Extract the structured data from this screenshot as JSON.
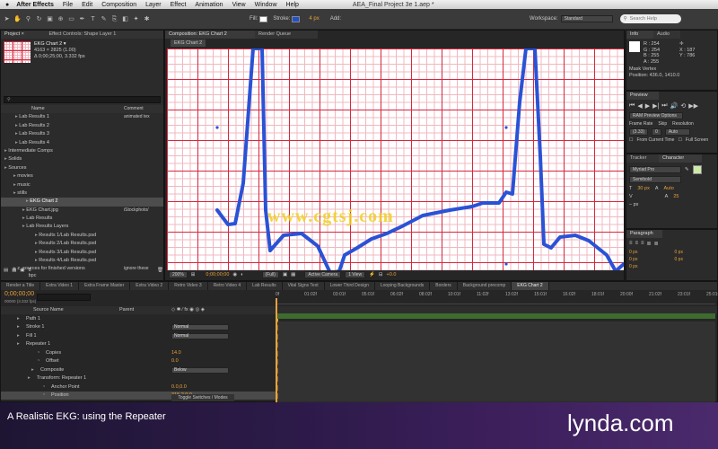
{
  "menubar": {
    "app": "After Effects",
    "items": [
      "File",
      "Edit",
      "Composition",
      "Layer",
      "Effect",
      "Animation",
      "View",
      "Window",
      "Help"
    ],
    "doc_title": "AEA_Final Project 3e 1.aep *"
  },
  "toolbar": {
    "fill_label": "Fill:",
    "stroke_label": "Stroke:",
    "stroke_width": "4 px",
    "add_label": "Add:",
    "workspace_label": "Workspace:",
    "workspace_value": "Standard",
    "search_placeholder": "Search Help"
  },
  "project": {
    "tab_project": "Project ×",
    "tab_effect": "Effect Controls: Shape Layer 1",
    "item_name": "EKG Chart 2 ▾",
    "item_size": "4163 × 2825 (1.00)",
    "item_duration": "Δ 0;00;25;00, 3.332 fps",
    "col_name": "Name",
    "col_comment": "Comment",
    "search_placeholder": "",
    "rows": [
      {
        "label": "Lab Results 1",
        "comment": "animated tex",
        "indent": 16,
        "sel": false
      },
      {
        "label": "Lab Results 2",
        "comment": "",
        "indent": 16,
        "sel": false
      },
      {
        "label": "Lab Results 3",
        "comment": "",
        "indent": 16,
        "sel": false
      },
      {
        "label": "Lab Results 4",
        "comment": "",
        "indent": 16,
        "sel": false
      },
      {
        "label": "Intermediate Comps",
        "comment": "",
        "indent": 4,
        "sel": false
      },
      {
        "label": "Solids",
        "comment": "",
        "indent": 4,
        "sel": false
      },
      {
        "label": "Sources",
        "comment": "",
        "indent": 4,
        "sel": false
      },
      {
        "label": "movies",
        "comment": "",
        "indent": 14,
        "sel": false
      },
      {
        "label": "music",
        "comment": "",
        "indent": 14,
        "sel": false
      },
      {
        "label": "stills",
        "comment": "",
        "indent": 14,
        "sel": false
      },
      {
        "label": "EKG Chart 2",
        "comment": "",
        "indent": 28,
        "sel": true
      },
      {
        "label": "EKG Chart.jpg",
        "comment": "iStockphoto/",
        "indent": 24,
        "sel": false
      },
      {
        "label": "Lab Results",
        "comment": "",
        "indent": 24,
        "sel": false
      },
      {
        "label": "Lab Results Layers",
        "comment": "",
        "indent": 24,
        "sel": false
      },
      {
        "label": "Results 1/Lab Results.psd",
        "comment": "",
        "indent": 38,
        "sel": false
      },
      {
        "label": "Results 2/Lab Results.psd",
        "comment": "",
        "indent": 38,
        "sel": false
      },
      {
        "label": "Results 3/Lab Results.psd",
        "comment": "",
        "indent": 38,
        "sel": false
      },
      {
        "label": "Results 4/Lab Results.psd",
        "comment": "",
        "indent": 38,
        "sel": false
      },
      {
        "label": "z_sources for finished versions",
        "comment": "ignore these",
        "indent": 14,
        "sel": false
      }
    ],
    "bpc": "8 bpc"
  },
  "composition": {
    "tab_comp": "Composition: EKG Chart 2",
    "tab_render": "Render Queue",
    "subtab": "EKG Chart 2",
    "zoom": "200%",
    "timecode": "0;00;00;00",
    "resolution": "(Full)",
    "camera": "Active Camera",
    "views": "1 View",
    "exposure": "+0.0"
  },
  "info": {
    "tab": "Info",
    "tab2": "Audio",
    "r": "R : 254",
    "g": "G : 254",
    "b": "B : 255",
    "a": "A : 255",
    "x": "X : 187",
    "y": "Y : 786",
    "mask": "Mask Vertex",
    "position": "Position: 436.0, 1410.0"
  },
  "preview": {
    "tab": "Preview",
    "ram": "RAM Preview Options",
    "frame_rate_label": "Frame Rate",
    "skip_label": "Skip",
    "resolution_label": "Resolution",
    "frame_rate": "(3.33)",
    "skip": "0",
    "resolution": "Auto",
    "from_current": "From Current Time",
    "full_screen": "Full Screen"
  },
  "character": {
    "tab_tracker": "Tracker",
    "tab_char": "Character",
    "font": "Myriad Pro",
    "style": "Semibold",
    "size": "30 px",
    "leading": "Auto",
    "tracking": "25",
    "unit": "– px"
  },
  "paragraph": {
    "tab": "Paragraph",
    "v1": "0 px",
    "v2": "0 px",
    "v3": "0 px",
    "v4": "0 px",
    "v5": "0 px"
  },
  "timeline": {
    "tabs": [
      "Render a Title",
      "Extra Video 1",
      "Extra Frame Master",
      "Extra Video 2",
      "Retro Video 3",
      "Retro Video 4",
      "Lab Results",
      "Vital Signs Text",
      "Lower Third Design",
      "Looping Backgrounds",
      "Borders",
      "Background precomp",
      "EKG Chart 2"
    ],
    "timecode": "0;00;00;00",
    "fps_note": "00000 (3.332 fps)",
    "col_source": "Source Name",
    "col_parent": "Parent",
    "ticks": [
      "0f",
      "01:02f",
      "03:01f",
      "05:01f",
      "06:02f",
      "08:02f",
      "10:01f",
      "11:02f",
      "13:02f",
      "15:01f",
      "16:02f",
      "18:01f",
      "20:00f",
      "21:02f",
      "23:01f",
      "25:01f"
    ],
    "toggle": "Toggle Switches / Modes",
    "rows": [
      {
        "label": "Path 1",
        "indent": 28,
        "value": "",
        "dd": ""
      },
      {
        "label": "Stroke 1",
        "indent": 28,
        "value": "",
        "dd": "Normal"
      },
      {
        "label": "Fill 1",
        "indent": 28,
        "value": "",
        "dd": "Normal"
      },
      {
        "label": "Repeater 1",
        "indent": 28,
        "value": "",
        "dd": ""
      },
      {
        "label": "Copies",
        "indent": 50,
        "value": "14.0",
        "dd": ""
      },
      {
        "label": "Offset",
        "indent": 50,
        "value": "0.0",
        "dd": ""
      },
      {
        "label": "Composite",
        "indent": 44,
        "value": "",
        "dd": "Below"
      },
      {
        "label": "Transform: Repeater 1",
        "indent": 40,
        "value": "",
        "dd": ""
      },
      {
        "label": "Anchor Point",
        "indent": 56,
        "value": "0.0,0.0",
        "dd": ""
      },
      {
        "label": "Position",
        "indent": 56,
        "value": "315.2,0.0",
        "dd": ""
      }
    ]
  },
  "caption": {
    "title": "A Realistic EKG: using the Repeater",
    "brand": "lynda",
    "brand_suffix": ".com"
  },
  "watermark": "www.cgtsj.com"
}
